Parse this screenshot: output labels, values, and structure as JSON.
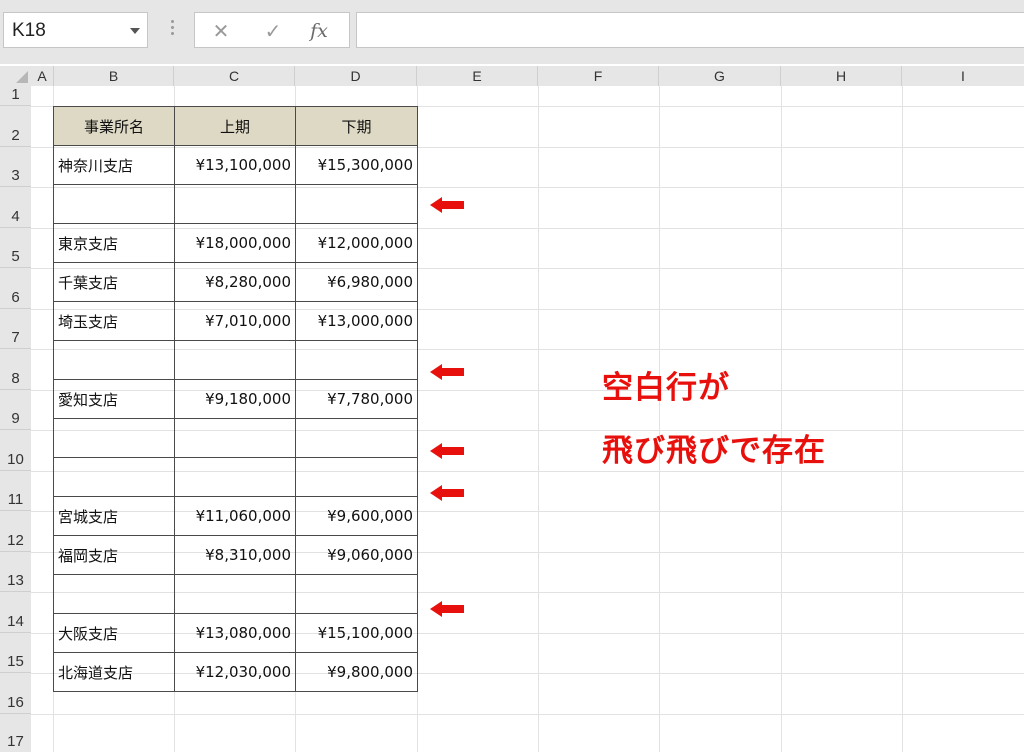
{
  "formula_bar": {
    "name_box": "K18",
    "cancel_icon": "✕",
    "enter_icon": "✓",
    "fx_label": "fx",
    "formula": ""
  },
  "columns": [
    "A",
    "B",
    "C",
    "D",
    "E",
    "F",
    "G",
    "H",
    "I"
  ],
  "rows": [
    "1",
    "2",
    "3",
    "4",
    "5",
    "6",
    "7",
    "8",
    "9",
    "10",
    "11",
    "12",
    "13",
    "14",
    "15",
    "16",
    "17"
  ],
  "table": {
    "headers": [
      "事業所名",
      "上期",
      "下期"
    ],
    "data": [
      [
        "神奈川支店",
        "¥13,100,000",
        "¥15,300,000"
      ],
      [
        "",
        "",
        ""
      ],
      [
        "東京支店",
        "¥18,000,000",
        "¥12,000,000"
      ],
      [
        "千葉支店",
        "¥8,280,000",
        "¥6,980,000"
      ],
      [
        "埼玉支店",
        "¥7,010,000",
        "¥13,000,000"
      ],
      [
        "",
        "",
        ""
      ],
      [
        "愛知支店",
        "¥9,180,000",
        "¥7,780,000"
      ],
      [
        "",
        "",
        ""
      ],
      [
        "",
        "",
        ""
      ],
      [
        "宮城支店",
        "¥11,060,000",
        "¥9,600,000"
      ],
      [
        "福岡支店",
        "¥8,310,000",
        "¥9,060,000"
      ],
      [
        "",
        "",
        ""
      ],
      [
        "大阪支店",
        "¥13,080,000",
        "¥15,100,000"
      ],
      [
        "北海道支店",
        "¥12,030,000",
        "¥9,800,000"
      ]
    ],
    "header_color": "#ddd9c4"
  },
  "annotation": {
    "line1": "空白行が",
    "line2": "飛び飛びで存在",
    "color": "#e8100c",
    "arrow_icon": "left-arrow-icon",
    "arrow_rows": [
      "4",
      "8",
      "10",
      "11",
      "14"
    ]
  }
}
